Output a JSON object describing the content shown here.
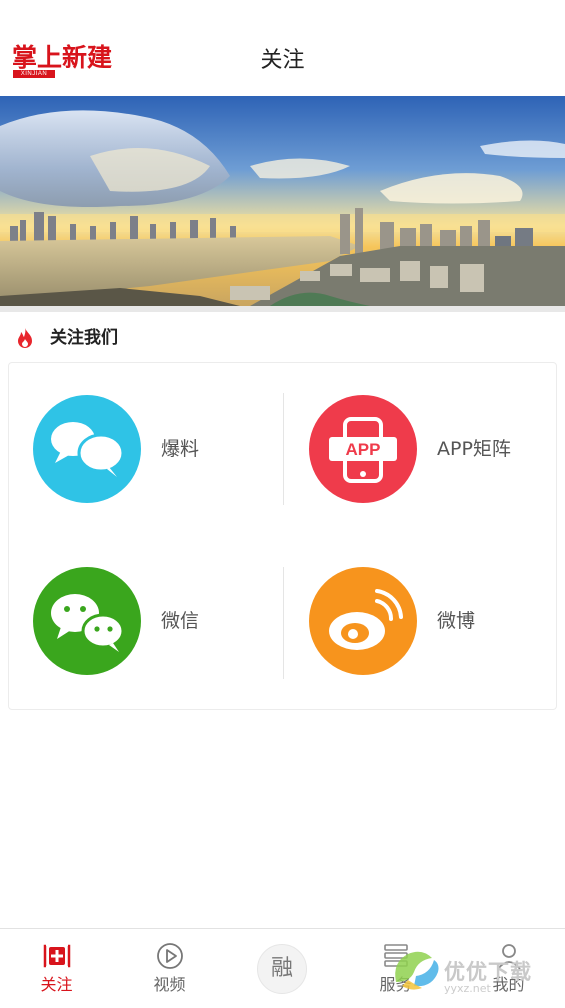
{
  "header": {
    "logo_text": "掌上新建",
    "logo_sub": "XINJIAN",
    "title": "关注"
  },
  "section": {
    "title": "关注我们",
    "icon": "fire-icon"
  },
  "tiles": [
    {
      "label": "爆料",
      "icon": "chat-bubbles-icon",
      "color": "#2fc3e6"
    },
    {
      "label": "APP矩阵",
      "icon": "app-phone-icon",
      "color": "#ef3b4b"
    },
    {
      "label": "微信",
      "icon": "wechat-icon",
      "color": "#3aa61d"
    },
    {
      "label": "微博",
      "icon": "weibo-icon",
      "color": "#f7941d"
    }
  ],
  "tabbar": {
    "items": [
      {
        "label": "关注",
        "icon": "plus-icon",
        "active": true
      },
      {
        "label": "视频",
        "icon": "play-icon",
        "active": false
      },
      {
        "label": "融",
        "icon": "center-icon",
        "active": false
      },
      {
        "label": "服务",
        "icon": "grid-list-icon",
        "active": false
      },
      {
        "label": "我的",
        "icon": "user-icon",
        "active": false
      }
    ]
  },
  "watermark": {
    "text": "优优下载",
    "url": "yyxz.net"
  },
  "colors": {
    "brand_red": "#d8141c",
    "tab_active": "#d8141c"
  }
}
